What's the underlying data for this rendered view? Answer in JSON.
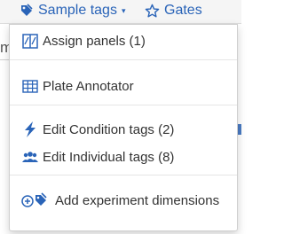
{
  "toolbar": {
    "sample_tags_label": "Sample tags",
    "gates_label": "Gates",
    "caret": "▾"
  },
  "background": {
    "peek_letter": "m"
  },
  "menu": {
    "items": [
      {
        "label": "Assign panels (1)",
        "icon": "panels-icon"
      },
      {
        "label": "Plate Annotator",
        "icon": "table-grid-icon"
      },
      {
        "label": "Edit Condition tags (2)",
        "icon": "lightning-icon"
      },
      {
        "label": "Edit Individual tags (8)",
        "icon": "people-icon"
      },
      {
        "label": "Add experiment dimensions",
        "icon": "add-tag-icon"
      }
    ]
  },
  "colors": {
    "accent": "#2a64b8",
    "menu_text": "#333333",
    "divider": "#e5e5e5"
  }
}
